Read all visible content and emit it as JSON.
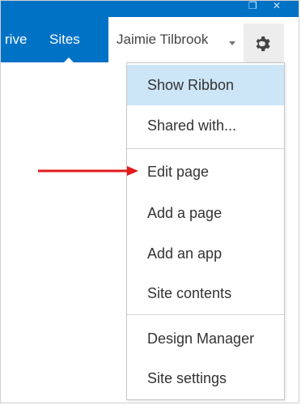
{
  "suite_bar": {
    "nav_items": [
      "rive",
      "Sites"
    ],
    "user_name": "Jaimie Tilbrook",
    "icons": {
      "settings": "gear-icon",
      "user_menu": "chevron-down-icon",
      "window_restore": "restore-icon",
      "window_close": "close-icon"
    },
    "colors": {
      "brand_blue": "#0072c6",
      "gear_background": "#ededed"
    }
  },
  "settings_menu": {
    "groups": [
      [
        "Show Ribbon",
        "Shared with..."
      ],
      [
        "Edit page",
        "Add a page",
        "Add an app",
        "Site contents"
      ],
      [
        "Design Manager",
        "Site settings"
      ]
    ],
    "highlighted_item": "Show Ribbon",
    "highlight_color": "#cde6f7"
  },
  "annotation": {
    "type": "arrow",
    "color": "#e21b1b",
    "points_to": "Edit page"
  }
}
